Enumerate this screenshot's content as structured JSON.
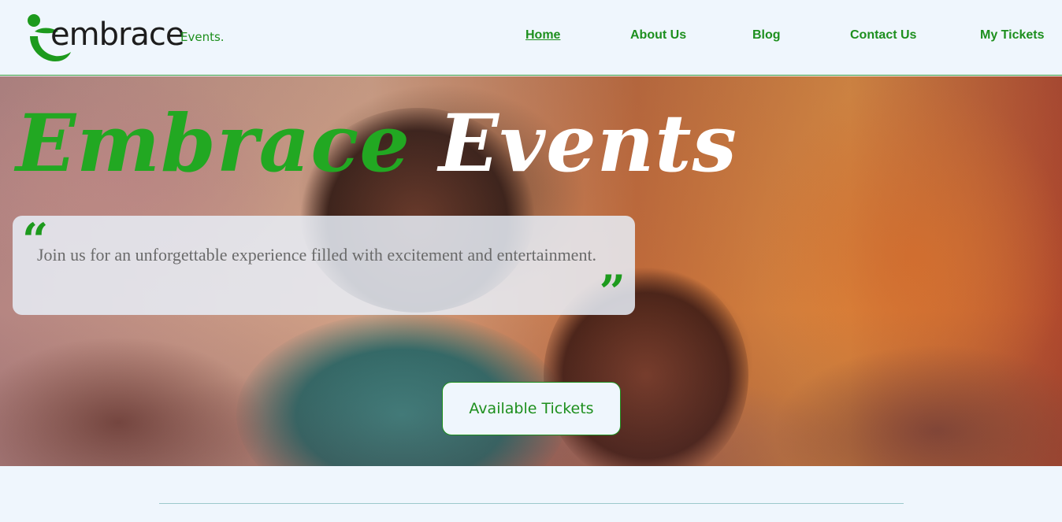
{
  "brand": {
    "logo_word": "embrace",
    "logo_sub": "Events.",
    "accent_color": "#1d8f1d",
    "logo_icon": "embrace-e-mark-icon"
  },
  "nav": {
    "items": [
      {
        "label": "Home",
        "active": true
      },
      {
        "label": "About Us",
        "active": false
      },
      {
        "label": "Blog",
        "active": false
      },
      {
        "label": "Contact Us",
        "active": false
      },
      {
        "label": "My Tickets",
        "active": false
      }
    ]
  },
  "hero": {
    "title_part1": "Embrace",
    "title_part2": "Events",
    "quote": "Join us for an unforgettable experience filled with excitement and entertainment.",
    "open_quote_glyph": "“",
    "close_quote_glyph": "”",
    "cta_label": "Available Tickets"
  }
}
